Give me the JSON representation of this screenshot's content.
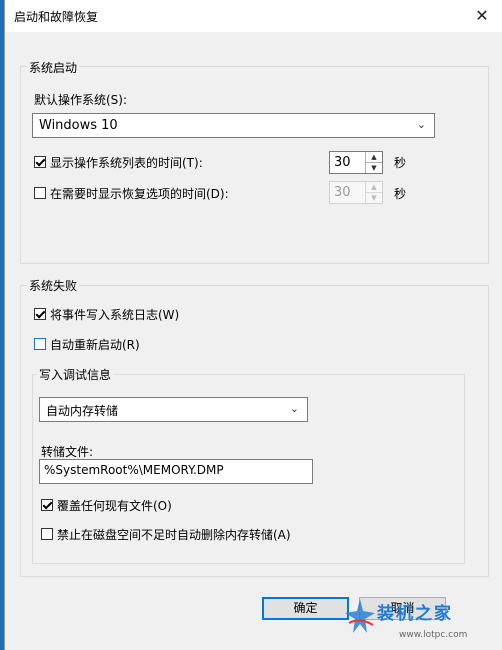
{
  "dialog": {
    "title": "启动和故障恢复",
    "close_glyph": "✕"
  },
  "startup": {
    "group_label": "系统启动",
    "default_os_label": "默认操作系统(S):",
    "default_os_value": "Windows 10",
    "show_list": {
      "label": "显示操作系统列表的时间(T):",
      "checked": true,
      "value": "30",
      "unit": "秒",
      "enabled": true
    },
    "show_recovery": {
      "label": "在需要时显示恢复选项的时间(D):",
      "checked": false,
      "value": "30",
      "unit": "秒",
      "enabled": false
    }
  },
  "failure": {
    "group_label": "系统失败",
    "write_event": {
      "label": "将事件写入系统日志(W)",
      "checked": true
    },
    "auto_restart": {
      "label": "自动重新启动(R)",
      "checked": false
    },
    "debug": {
      "group_label": "写入调试信息",
      "dump_type": "自动内存转储",
      "dump_file_label": "转储文件:",
      "dump_file_value": "%SystemRoot%\\MEMORY.DMP",
      "overwrite": {
        "label": "覆盖任何现有文件(O)",
        "checked": true
      },
      "disable_auto_delete": {
        "label": "禁止在磁盘空间不足时自动删除内存转储(A)",
        "checked": false
      }
    }
  },
  "buttons": {
    "ok": "确定",
    "cancel": "取消"
  },
  "watermark": {
    "name": "装机之家",
    "url": "www.lotpc.com"
  },
  "colors": {
    "accent": "#0078d7",
    "titlebar": "#ffffff",
    "window_bg": "#f0f0f0"
  },
  "icons": {
    "combo_arrow": "chevron-down-icon",
    "spin_up": "triangle-up-icon",
    "spin_down": "triangle-down-icon",
    "close": "close-icon"
  }
}
